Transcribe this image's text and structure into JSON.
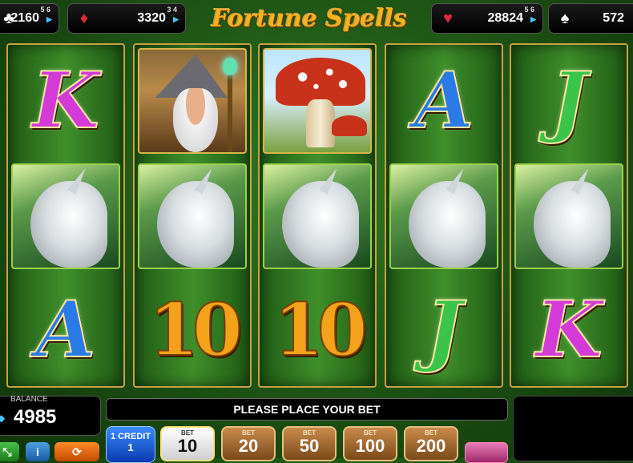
{
  "game": {
    "title": "Fortune Spells"
  },
  "jackpots": [
    {
      "suit": "clubs",
      "icon": "club-icon",
      "value": "2160",
      "digits": "5 6",
      "color": "#ffffff"
    },
    {
      "suit": "diamonds",
      "icon": "diamond-icon",
      "value": "3320",
      "digits": "3 4",
      "color": "#e0283a"
    },
    {
      "suit": "hearts",
      "icon": "heart-icon",
      "value": "28824",
      "digits": "5 6",
      "color": "#e0283a"
    },
    {
      "suit": "spades",
      "icon": "spade-icon",
      "value": "572",
      "digits": "",
      "color": "#ffffff"
    }
  ],
  "reels": [
    {
      "symbols": [
        {
          "type": "letter",
          "text": "K",
          "color": "#d33ad8"
        },
        {
          "type": "image",
          "name": "unicorn"
        },
        {
          "type": "letter",
          "text": "A",
          "color": "#2a7ae8"
        }
      ]
    },
    {
      "symbols": [
        {
          "type": "image",
          "name": "wizard"
        },
        {
          "type": "image",
          "name": "unicorn"
        },
        {
          "type": "ten",
          "text": "10"
        }
      ]
    },
    {
      "symbols": [
        {
          "type": "image",
          "name": "mushroom"
        },
        {
          "type": "image",
          "name": "unicorn"
        },
        {
          "type": "ten",
          "text": "10"
        }
      ]
    },
    {
      "symbols": [
        {
          "type": "letter",
          "text": "A",
          "color": "#2a7ae8"
        },
        {
          "type": "image",
          "name": "unicorn"
        },
        {
          "type": "letter",
          "text": "J",
          "color": "#3ac44a"
        }
      ]
    },
    {
      "symbols": [
        {
          "type": "letter",
          "text": "J",
          "color": "#3ac44a"
        },
        {
          "type": "image",
          "name": "unicorn"
        },
        {
          "type": "letter",
          "text": "K",
          "color": "#d33ad8"
        }
      ]
    }
  ],
  "balance": {
    "label": "BALANCE",
    "value": "4985"
  },
  "message": "PLEASE PLACE YOUR BET",
  "credit": {
    "label": "1 CREDIT",
    "value": "1"
  },
  "bets": [
    {
      "label": "BET",
      "value": "10",
      "active": true
    },
    {
      "label": "BET",
      "value": "20",
      "active": false
    },
    {
      "label": "BET",
      "value": "50",
      "active": false
    },
    {
      "label": "BET",
      "value": "100",
      "active": false
    },
    {
      "label": "BET",
      "value": "200",
      "active": false
    }
  ]
}
